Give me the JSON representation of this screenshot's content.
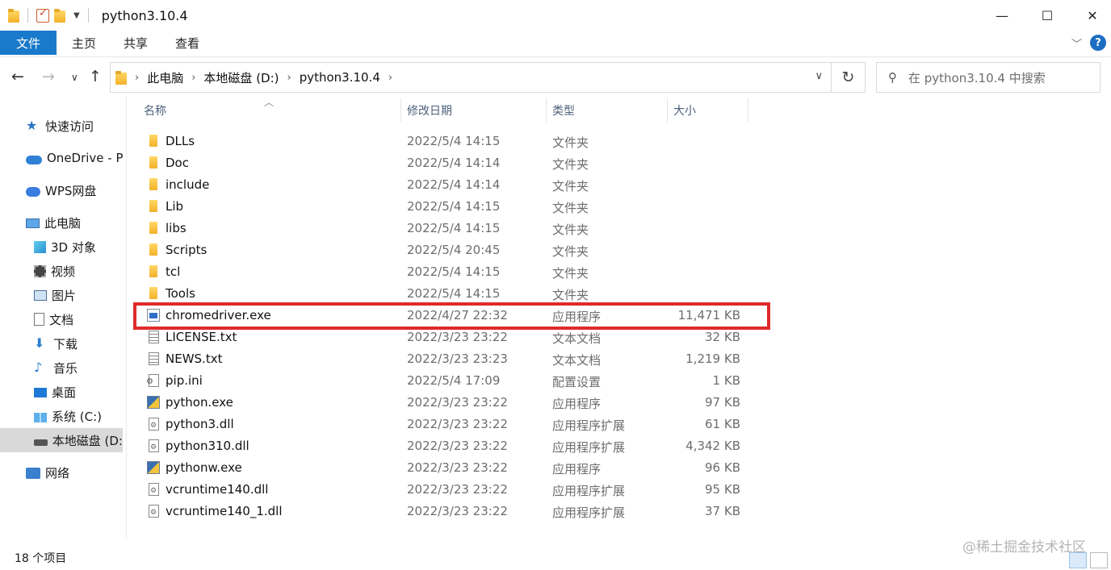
{
  "window": {
    "title": "python3.10.4",
    "controls": {
      "minimize": "—",
      "maximize": "☐",
      "close": "✕"
    }
  },
  "ribbon": {
    "tabs": [
      "文件",
      "主页",
      "共享",
      "查看"
    ],
    "help": "?"
  },
  "address": {
    "crumbs": [
      "此电脑",
      "本地磁盘 (D:)",
      "python3.10.4"
    ],
    "search_placeholder": "在 python3.10.4 中搜索"
  },
  "sidebar": {
    "items": [
      {
        "label": "快速访问",
        "icon": "star-icon"
      },
      {
        "label": "OneDrive - Pe",
        "icon": "onedrive-icon"
      },
      {
        "label": "WPS网盘",
        "icon": "wps-cloud-icon"
      },
      {
        "label": "此电脑",
        "icon": "computer-icon"
      },
      {
        "label": "3D 对象",
        "icon": "cube-icon"
      },
      {
        "label": "视频",
        "icon": "video-icon"
      },
      {
        "label": "图片",
        "icon": "picture-icon"
      },
      {
        "label": "文档",
        "icon": "document-icon"
      },
      {
        "label": "下载",
        "icon": "download-icon"
      },
      {
        "label": "音乐",
        "icon": "music-icon"
      },
      {
        "label": "桌面",
        "icon": "desktop-icon"
      },
      {
        "label": "系统 (C:)",
        "icon": "windows-drive-icon"
      },
      {
        "label": "本地磁盘 (D:",
        "icon": "drive-icon"
      },
      {
        "label": "网络",
        "icon": "network-icon"
      }
    ]
  },
  "list": {
    "columns": {
      "name": "名称",
      "date": "修改日期",
      "type": "类型",
      "size": "大小"
    },
    "rows": [
      {
        "name": "DLLs",
        "date": "2022/5/4 14:15",
        "type": "文件夹",
        "size": "",
        "icon": "folder"
      },
      {
        "name": "Doc",
        "date": "2022/5/4 14:14",
        "type": "文件夹",
        "size": "",
        "icon": "folder"
      },
      {
        "name": "include",
        "date": "2022/5/4 14:14",
        "type": "文件夹",
        "size": "",
        "icon": "folder"
      },
      {
        "name": "Lib",
        "date": "2022/5/4 14:15",
        "type": "文件夹",
        "size": "",
        "icon": "folder"
      },
      {
        "name": "libs",
        "date": "2022/5/4 14:15",
        "type": "文件夹",
        "size": "",
        "icon": "folder"
      },
      {
        "name": "Scripts",
        "date": "2022/5/4 20:45",
        "type": "文件夹",
        "size": "",
        "icon": "folder"
      },
      {
        "name": "tcl",
        "date": "2022/5/4 14:15",
        "type": "文件夹",
        "size": "",
        "icon": "folder"
      },
      {
        "name": "Tools",
        "date": "2022/5/4 14:15",
        "type": "文件夹",
        "size": "",
        "icon": "folder"
      },
      {
        "name": "chromedriver.exe",
        "date": "2022/4/27 22:32",
        "type": "应用程序",
        "size": "11,471 KB",
        "icon": "exe"
      },
      {
        "name": "LICENSE.txt",
        "date": "2022/3/23 23:22",
        "type": "文本文档",
        "size": "32 KB",
        "icon": "txt"
      },
      {
        "name": "NEWS.txt",
        "date": "2022/3/23 23:23",
        "type": "文本文档",
        "size": "1,219 KB",
        "icon": "txt"
      },
      {
        "name": "pip.ini",
        "date": "2022/5/4 17:09",
        "type": "配置设置",
        "size": "1 KB",
        "icon": "ini"
      },
      {
        "name": "python.exe",
        "date": "2022/3/23 23:22",
        "type": "应用程序",
        "size": "97 KB",
        "icon": "py"
      },
      {
        "name": "python3.dll",
        "date": "2022/3/23 23:22",
        "type": "应用程序扩展",
        "size": "61 KB",
        "icon": "dll"
      },
      {
        "name": "python310.dll",
        "date": "2022/3/23 23:22",
        "type": "应用程序扩展",
        "size": "4,342 KB",
        "icon": "dll"
      },
      {
        "name": "pythonw.exe",
        "date": "2022/3/23 23:22",
        "type": "应用程序",
        "size": "96 KB",
        "icon": "pyw"
      },
      {
        "name": "vcruntime140.dll",
        "date": "2022/3/23 23:22",
        "type": "应用程序扩展",
        "size": "95 KB",
        "icon": "dll"
      },
      {
        "name": "vcruntime140_1.dll",
        "date": "2022/3/23 23:22",
        "type": "应用程序扩展",
        "size": "37 KB",
        "icon": "dll"
      }
    ]
  },
  "status": {
    "item_count": "18 个项目"
  },
  "watermark": "@稀土掘金技术社区",
  "colors": {
    "file_tab": "#1979ca",
    "highlight": "#e02a2a",
    "help": "#1b6ec2"
  }
}
